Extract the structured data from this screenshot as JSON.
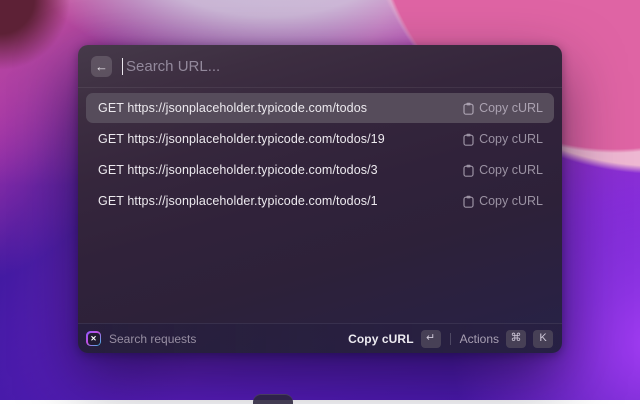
{
  "colors": {
    "selection_bg": "#564C5B",
    "key_badge_bg": "#474056",
    "window_bg": "#30223A",
    "wallpaper_pink": "#DF64A4",
    "wallpaper_violet": "#7D28D0"
  },
  "icons": {
    "back": "←",
    "extension": "✕",
    "return_key": "↵",
    "command_key": "⌘"
  },
  "window": {
    "header": {
      "search_placeholder": "Search URL..."
    },
    "list": {
      "items": [
        {
          "label": "GET https://jsonplaceholder.typicode.com/todos",
          "action": "Copy cURL",
          "selected": true
        },
        {
          "label": "GET https://jsonplaceholder.typicode.com/todos/19",
          "action": "Copy cURL",
          "selected": false
        },
        {
          "label": "GET https://jsonplaceholder.typicode.com/todos/3",
          "action": "Copy cURL",
          "selected": false
        },
        {
          "label": "GET https://jsonplaceholder.typicode.com/todos/1",
          "action": "Copy cURL",
          "selected": false
        }
      ]
    },
    "footer": {
      "command_label": "Search requests",
      "primary_action": "Copy cURL",
      "secondary_action": "Actions",
      "secondary_key_letter": "K"
    }
  }
}
